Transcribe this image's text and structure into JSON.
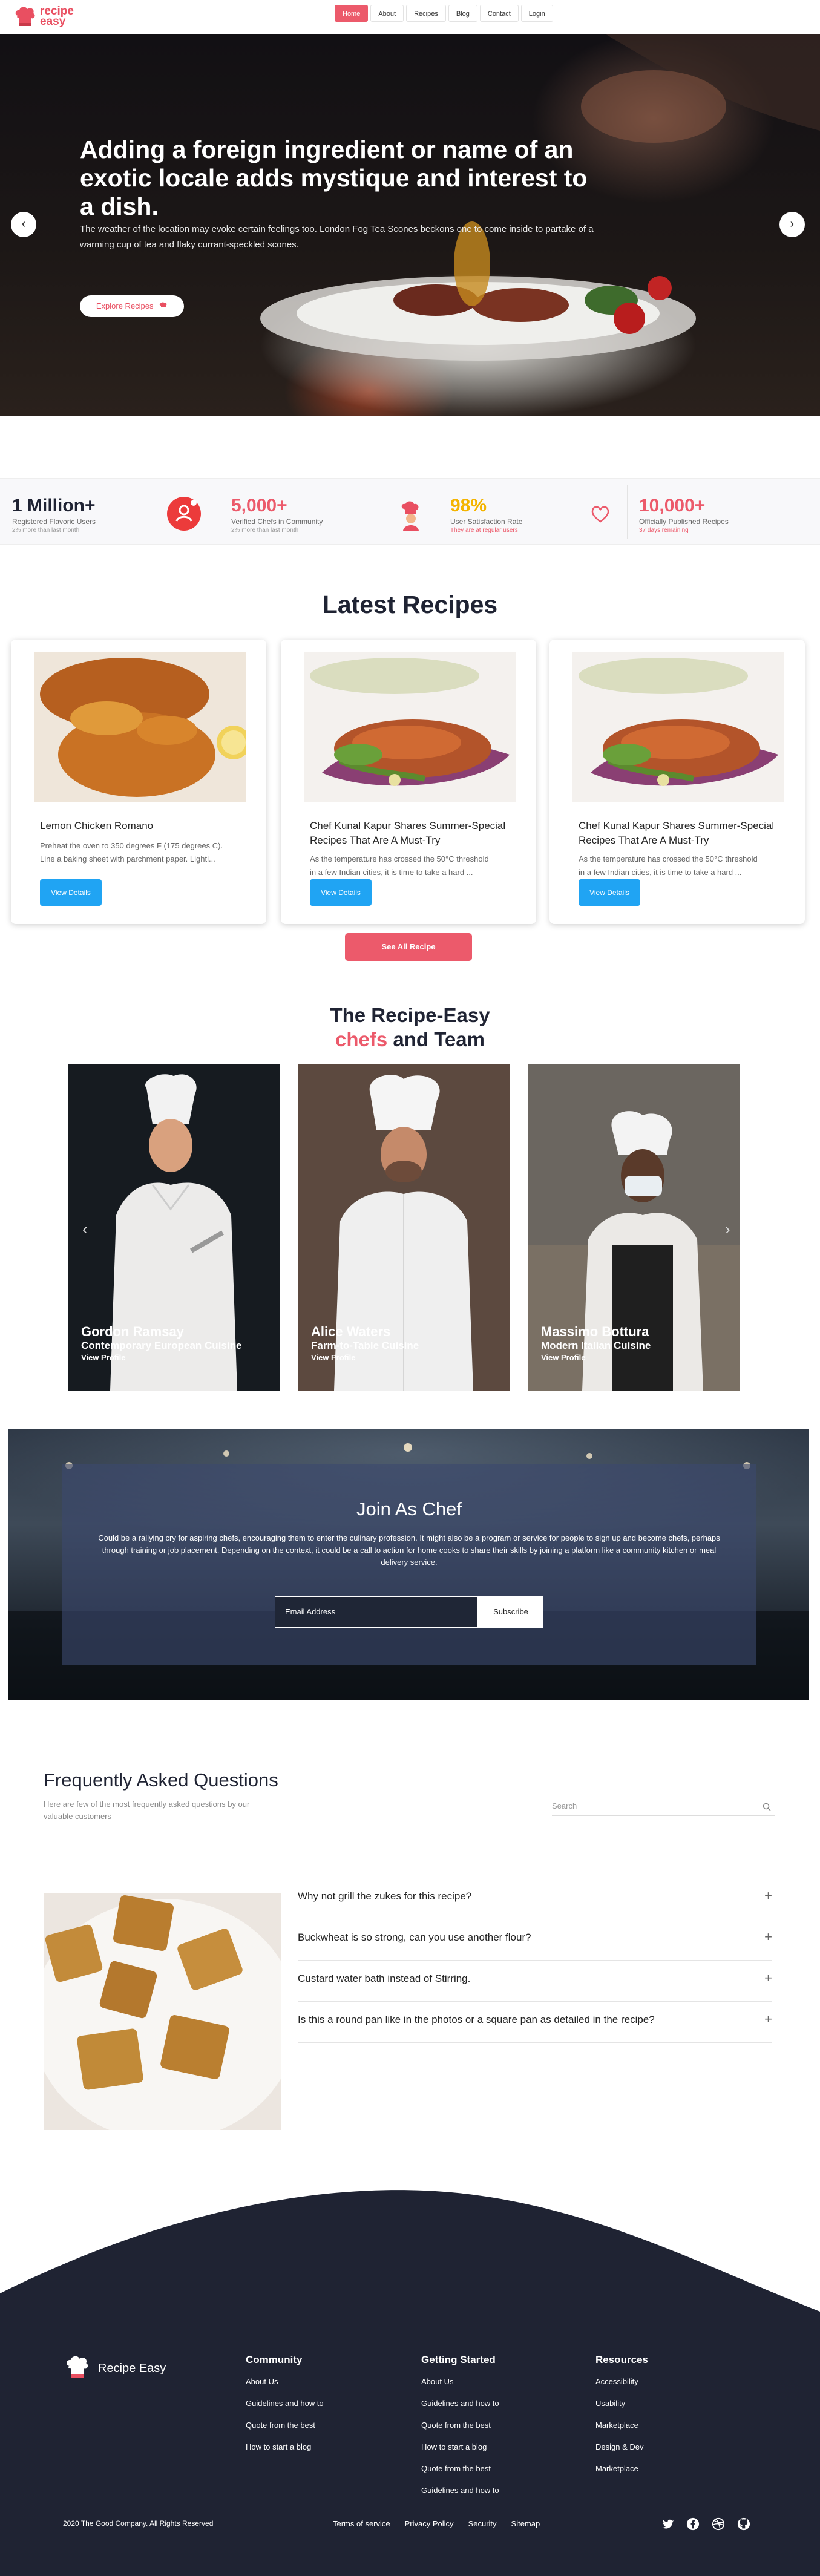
{
  "brand": {
    "name_line1": "recipe",
    "name_line2": "easy",
    "footer_name": "Recipe Easy"
  },
  "nav": {
    "items": [
      {
        "label": "Home",
        "active": true
      },
      {
        "label": "About",
        "active": false
      },
      {
        "label": "Recipes",
        "active": false
      },
      {
        "label": "Blog",
        "active": false
      },
      {
        "label": "Contact",
        "active": false
      },
      {
        "label": "Login",
        "active": false
      }
    ]
  },
  "hero": {
    "title": "Adding a foreign ingredient or name of an exotic locale adds mystique and interest to a dish.",
    "text": "The weather of the location may evoke certain feelings too. London Fog Tea Scones beckons one to come inside to partake of a warming cup of tea and flaky currant-speckled scones.",
    "button_label": "Explore Recipes",
    "prev_glyph": "‹",
    "next_glyph": "›"
  },
  "stats": [
    {
      "value": "1 Million+",
      "label": "Registered Flavoric Users",
      "sub": "2% more than last month",
      "value_color": "#1f2333",
      "sub_color": "#999999",
      "icon": "user-icon"
    },
    {
      "value": "5,000+",
      "label": "Verified Chefs in Community",
      "sub": "2% more than last month",
      "value_color": "#ec5a6b",
      "sub_color": "#999999",
      "icon": "chef-icon"
    },
    {
      "value": "98%",
      "label": "User Satisfaction Rate",
      "sub": "They are at regular users",
      "value_color": "#f4b400",
      "sub_color": "#ec5a6b",
      "icon": "heart-icon"
    },
    {
      "value": "10,000+",
      "label": "Officially Published Recipes",
      "sub": "37 days remaining",
      "value_color": "#ec5a6b",
      "sub_color": "#ec5a6b",
      "icon": ""
    }
  ],
  "latest": {
    "title": "Latest Recipes",
    "cards": [
      {
        "title": "Lemon Chicken Romano",
        "excerpt_line1": "Preheat the oven to 350 degrees F (175 degrees C).",
        "excerpt_line2": "Line a baking sheet with parchment paper. Lightl...",
        "button": "View Details"
      },
      {
        "title": "Chef Kunal Kapur Shares Summer-Special Recipes That Are A Must-Try",
        "excerpt_line1": "As the temperature has crossed the 50°C threshold",
        "excerpt_line2": "in a few Indian cities, it is time to take a hard ...",
        "button": "View Details"
      },
      {
        "title": "Chef Kunal Kapur Shares Summer-Special Recipes That Are A Must-Try",
        "excerpt_line1": "As the temperature has crossed the 50°C threshold",
        "excerpt_line2": "in a few Indian cities, it is time to take a hard ...",
        "button": "View Details"
      }
    ],
    "see_all": "See All Recipe"
  },
  "chefs": {
    "title_line1": "The Recipe-Easy",
    "title_highlight": "chefs",
    "title_rest": " and Team",
    "items": [
      {
        "name": "Gordon Ramsay",
        "cuisine": "Contemporary European Cuisine",
        "link": "View Profile"
      },
      {
        "name": "Alice Waters",
        "cuisine": "Farm-to-Table Cuisine",
        "link": "View Profile"
      },
      {
        "name": "Massimo Bottura",
        "cuisine": "Modern Italian Cuisine",
        "link": "View Profile"
      }
    ],
    "prev_glyph": "‹",
    "next_glyph": "›"
  },
  "join": {
    "title": "Join As Chef",
    "text": "Could be a rallying cry for aspiring chefs, encouraging them to enter the culinary profession. It might also be a program or service for people to sign up and become chefs, perhaps through training or job placement. Depending on the context, it could be a call to action for home cooks to share their skills by joining a platform like a community kitchen or meal delivery service.",
    "input_placeholder": "Email Address",
    "button": "Subscribe"
  },
  "faq": {
    "title": "Frequently Asked Questions",
    "subtitle": "Here are few of the most frequently asked questions by our valuable customers",
    "search_placeholder": "Search",
    "items": [
      {
        "question": "Why not grill the zukes for this recipe?"
      },
      {
        "question": "Buckwheat is so strong, can you use another flour?"
      },
      {
        "question": "Custard water bath instead of Stirring."
      },
      {
        "question": "Is this a round pan like in the photos or a square pan as detailed in the recipe?"
      }
    ],
    "plus_glyph": "+"
  },
  "footer": {
    "columns": [
      {
        "title": "Community",
        "links": [
          "About Us",
          "Guidelines and how to",
          "Quote from the best",
          "How to start a blog"
        ]
      },
      {
        "title": "Getting Started",
        "links": [
          "About Us",
          "Guidelines and how to",
          "Quote from the best",
          "How to start a blog",
          "Quote from the best",
          "Guidelines and how to"
        ]
      },
      {
        "title": "Resources",
        "links": [
          "Accessibility",
          "Usability",
          "Marketplace",
          "Design & Dev",
          "Marketplace"
        ]
      }
    ],
    "copyright": "2020 The Good Company. All Rights Reserved",
    "legal": [
      "Terms of service",
      "Privacy Policy",
      "Security",
      "Sitemap"
    ],
    "social": [
      "twitter-icon",
      "facebook-icon",
      "dribbble-icon",
      "github-icon"
    ]
  },
  "colors": {
    "accent": "#ec5a6b",
    "button_blue": "#20a4f3",
    "footer_bg": "#1f2333"
  }
}
